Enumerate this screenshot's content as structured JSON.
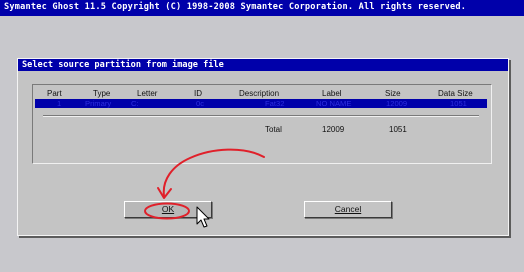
{
  "topbar": {
    "title": "Symantec Ghost 11.5   Copyright (C) 1998-2008 Symantec Corporation. All rights reserved."
  },
  "dialog": {
    "title": "Select source partition from image file",
    "columns": [
      "Part",
      "Type",
      "Letter",
      "ID",
      "Description",
      "Label",
      "Size",
      "Data Size"
    ],
    "rows": [
      {
        "part": "1",
        "type": "Primary",
        "letter": "C:",
        "id": "0c",
        "description": "Fat32",
        "label": "NO NAME",
        "size": "12009",
        "data_size": "1051"
      }
    ],
    "total": {
      "label": "Total",
      "size": "12009",
      "data_size": "1051"
    },
    "ok_label": "OK",
    "cancel_label": "Cancel"
  },
  "colors": {
    "title_bar": "#0000aa",
    "dialog_bg": "#c4c4c4",
    "annotation": "#e0202a"
  },
  "icons": {
    "cursor": "arrow-cursor-icon"
  }
}
